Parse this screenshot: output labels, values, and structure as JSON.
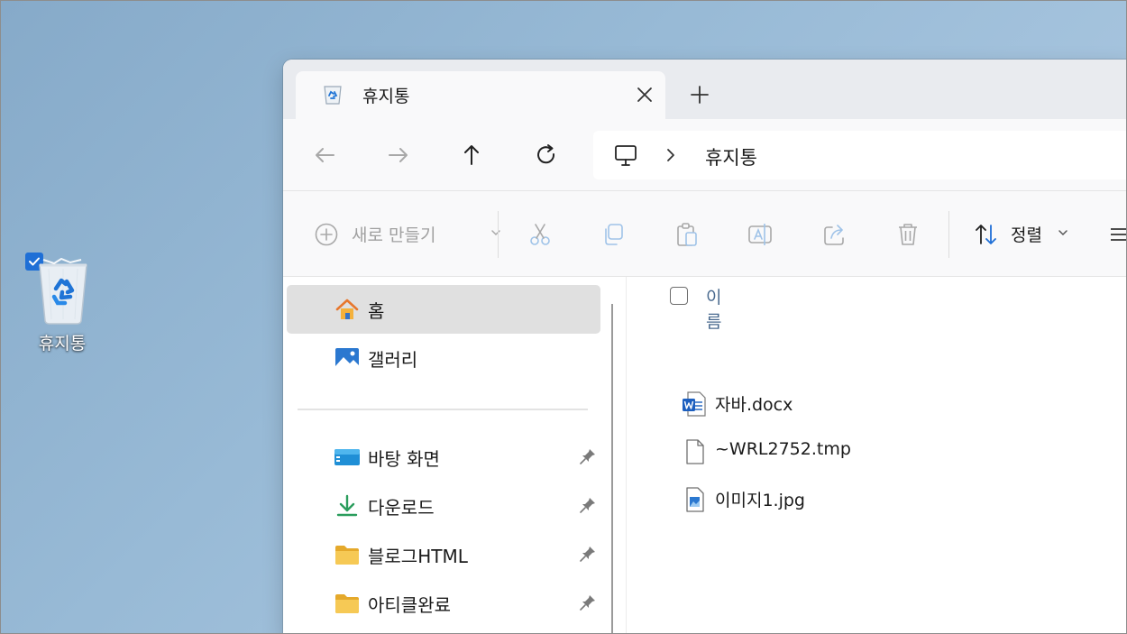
{
  "desktop": {
    "recycle_bin_label": "휴지통"
  },
  "window": {
    "tab": {
      "title": "휴지통"
    },
    "address": {
      "location": "휴지통"
    },
    "commands": {
      "new_label": "새로 만들기",
      "sort_label": "정렬"
    },
    "nav": {
      "top_items": [
        {
          "label": "홈",
          "icon": "home-icon",
          "selected": true
        },
        {
          "label": "갤러리",
          "icon": "gallery-icon",
          "selected": false
        }
      ],
      "quick_access": [
        {
          "label": "바탕 화면",
          "icon": "desktop-folder-icon",
          "pinned": true
        },
        {
          "label": "다운로드",
          "icon": "download-icon",
          "pinned": true
        },
        {
          "label": "블로그HTML",
          "icon": "folder-icon",
          "pinned": true
        },
        {
          "label": "아티클완료",
          "icon": "folder-icon",
          "pinned": true
        }
      ]
    },
    "files": {
      "column_name": "이름",
      "items": [
        {
          "name": "자바.docx",
          "icon": "word-document-icon"
        },
        {
          "name": "~WRL2752.tmp",
          "icon": "blank-file-icon"
        },
        {
          "name": "이미지1.jpg",
          "icon": "image-file-icon"
        }
      ]
    }
  },
  "colors": {
    "accent": "#1f6fd6",
    "folder": "#f3c04a",
    "download": "#2a9d5c"
  }
}
